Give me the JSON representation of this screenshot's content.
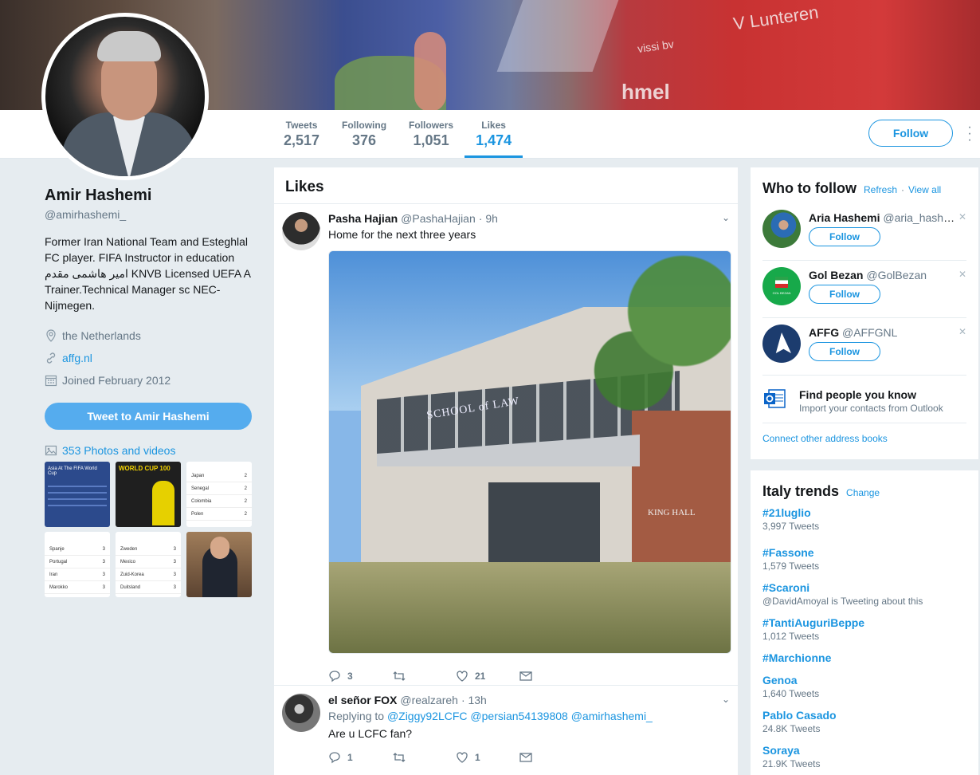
{
  "banner": {
    "text_name": "V Lunteren",
    "text_brand": "hmel",
    "text_sponsor": "vissi bv"
  },
  "stats": [
    {
      "label": "Tweets",
      "value": "2,517"
    },
    {
      "label": "Following",
      "value": "376"
    },
    {
      "label": "Followers",
      "value": "1,051"
    },
    {
      "label": "Likes",
      "value": "1,474"
    }
  ],
  "follow_label": "Follow",
  "profile": {
    "name": "Amir Hashemi",
    "handle": "@amirhashemi_",
    "bio": "Former Iran National Team and Esteghlal FC player. FIFA Instructor in education امیر هاشمی مقدم KNVB Licensed UEFA A Trainer.Technical Manager sc NEC-Nijmegen.",
    "location": "the Netherlands",
    "url": "affg.nl",
    "joined": "Joined February 2012",
    "tweet_to": "Tweet to Amir Hashemi",
    "photos": "353 Photos and videos"
  },
  "thumbs": {
    "t1_title": "Asia At The FIFA World Cup",
    "t2_title": "WORLD CUP 100",
    "t3_rows": [
      "Japan",
      "Senegal",
      "Colombia",
      "Polen"
    ],
    "t3_vals": [
      "2",
      "2",
      "2",
      "2"
    ],
    "t4_rows": [
      "Spanje",
      "Portugal",
      "Iran",
      "Marokko"
    ],
    "t4_vals": [
      "3",
      "3",
      "3",
      "3"
    ],
    "t5_rows": [
      "Zweden",
      "Mexico",
      "Zuid-Korea",
      "Duitsland"
    ],
    "t5_vals": [
      "3",
      "3",
      "3",
      "3"
    ]
  },
  "timeline": {
    "header": "Likes",
    "tweets": [
      {
        "name": "Pasha Hajian",
        "handle": "@PashaHajian",
        "date": "· 9h",
        "text": "Home for the next three years",
        "image_text": "SCHOOL of LAW",
        "image_text2": "KING HALL",
        "replies": "3",
        "likes": "21"
      },
      {
        "name": "el señor FOX",
        "handle": "@realzareh",
        "date": "· 13h",
        "replying": "Replying to",
        "mentions": "@Ziggy92LCFC @persian54139808 @amirhashemi_",
        "text": "Are u LCFC fan?",
        "replies": "1",
        "likes": "1"
      }
    ]
  },
  "who_to_follow": {
    "title": "Who to follow",
    "refresh": "Refresh",
    "dot": "·",
    "view_all": "View all",
    "users": [
      {
        "name": "Aria Hashemi",
        "handle": "@aria_hashemi"
      },
      {
        "name": "Gol Bezan",
        "handle": "@GolBezan",
        "avatar_text": "GOL BEZAN"
      },
      {
        "name": "AFFG",
        "handle": "@AFFGNL"
      }
    ],
    "find_title": "Find people you know",
    "find_sub": "Import your contacts from Outlook",
    "connect": "Connect other address books"
  },
  "trends": {
    "title": "Italy trends",
    "change": "Change",
    "items": [
      {
        "name": "#21luglio",
        "count": "3,997 Tweets"
      },
      {
        "name": "#Fassone",
        "count": "1,579 Tweets"
      },
      {
        "name": "#Scaroni",
        "count": "@DavidAmoyal is Tweeting about this"
      },
      {
        "name": "#TantiAuguriBeppe",
        "count": "1,012 Tweets"
      },
      {
        "name": "#Marchionne",
        "count": ""
      },
      {
        "name": "Genoa",
        "count": "1,640 Tweets"
      },
      {
        "name": "Pablo Casado",
        "count": "24.8K Tweets"
      },
      {
        "name": "Soraya",
        "count": "21.9K Tweets"
      }
    ]
  },
  "colors": {
    "accent": "#1b95e0",
    "tweet_button": "#55acee",
    "background": "#e6ecf0"
  }
}
